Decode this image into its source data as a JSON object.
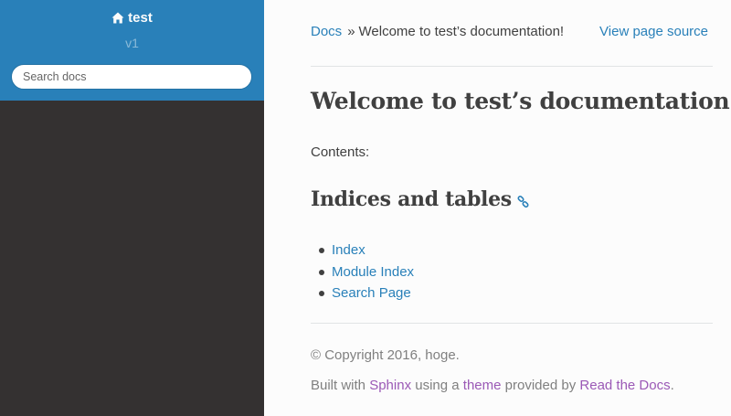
{
  "sidebar": {
    "project_name": "test",
    "version": "v1",
    "search_placeholder": "Search docs",
    "colors": {
      "header_bg": "#2980b9",
      "nav_bg": "#343131"
    }
  },
  "breadcrumbs": {
    "root": "Docs",
    "separator": "»",
    "current": "Welcome to test’s documentation!",
    "view_source": "View page source"
  },
  "main": {
    "title": "Welcome to test’s documentation!",
    "contents_caption": "Contents:",
    "section_title": "Indices and tables",
    "links": [
      "Index",
      "Module Index",
      "Search Page"
    ]
  },
  "footer": {
    "copyright": "© Copyright 2016, hoge.",
    "built_prefix": "Built with ",
    "sphinx": "Sphinx",
    "middle_1": " using a ",
    "theme": "theme",
    "middle_2": " provided by ",
    "rtd": "Read the Docs",
    "suffix": "."
  },
  "icons": {
    "home": "home-icon",
    "headerlink": "link-icon"
  },
  "colors": {
    "link": "#2980b9",
    "visited_link": "#9b59b6",
    "text": "#404040",
    "muted": "#808080"
  }
}
